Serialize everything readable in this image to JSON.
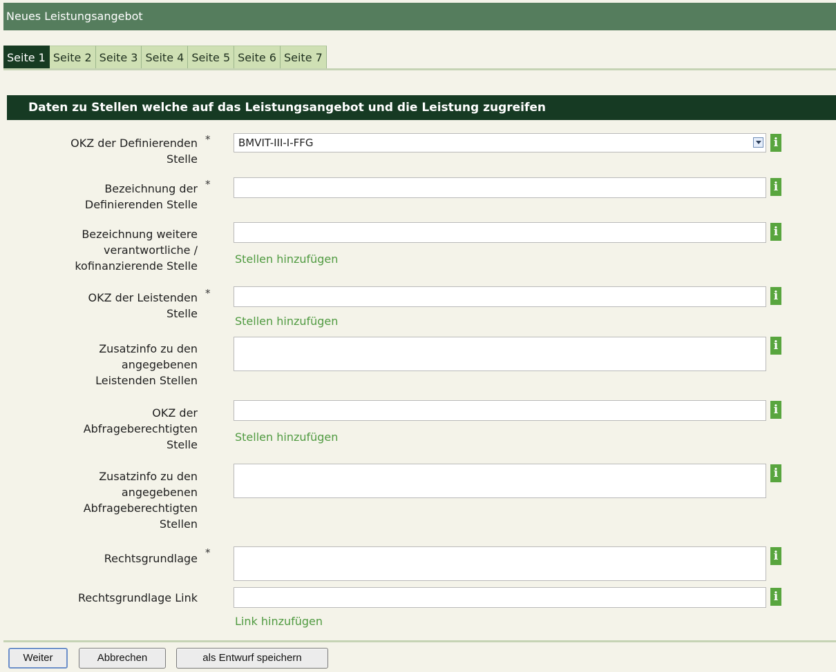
{
  "window": {
    "title": "Neues Leistungsangebot"
  },
  "tabs": [
    "Seite 1",
    "Seite 2",
    "Seite 3",
    "Seite 4",
    "Seite 5",
    "Seite 6",
    "Seite 7"
  ],
  "section": {
    "title": "Daten zu Stellen welche auf das Leistungsangebot und die Leistung zugreifen"
  },
  "required_marker": "*",
  "info_glyph": "i",
  "fields": {
    "okz_definierende": {
      "label": [
        "OKZ der Definierenden",
        "Stelle"
      ],
      "value": "BMVIT-III-I-FFG"
    },
    "bez_definierende": {
      "label": [
        "Bezeichnung der",
        "Definierenden Stelle"
      ],
      "value": ""
    },
    "bez_weitere": {
      "label": [
        "Bezeichnung weitere",
        "verantwortliche /",
        "kofinanzierende Stelle"
      ],
      "value": "",
      "link": "Stellen hinzufügen"
    },
    "okz_leistende": {
      "label": [
        "OKZ der Leistenden",
        "Stelle"
      ],
      "value": "",
      "link": "Stellen hinzufügen"
    },
    "zusatz_leistende": {
      "label": [
        "Zusatzinfo zu den",
        "angegebenen",
        "Leistenden Stellen"
      ],
      "value": ""
    },
    "okz_abfrage": {
      "label": [
        "OKZ der",
        "Abfrageberechtigten",
        "Stelle"
      ],
      "value": "",
      "link": "Stellen hinzufügen"
    },
    "zusatz_abfrage": {
      "label": [
        "Zusatzinfo zu den",
        "angegebenen",
        "Abfrageberechtigten",
        "Stellen"
      ],
      "value": ""
    },
    "rechtsgrundlage": {
      "label": [
        "Rechtsgrundlage"
      ],
      "value": ""
    },
    "rechtsgrundlage_link": {
      "label": [
        "Rechtsgrundlage Link"
      ],
      "value": "",
      "link": "Link hinzufügen"
    }
  },
  "buttons": {
    "next": "Weiter",
    "cancel": "Abbrechen",
    "draft": "als Entwurf speichern"
  },
  "colors": {
    "title_bar": "#557d5d",
    "active_tab": "#173b22",
    "tab": "#cfe0b4",
    "section_header": "#163a23",
    "info": "#58a53e",
    "link": "#4f9a40"
  }
}
